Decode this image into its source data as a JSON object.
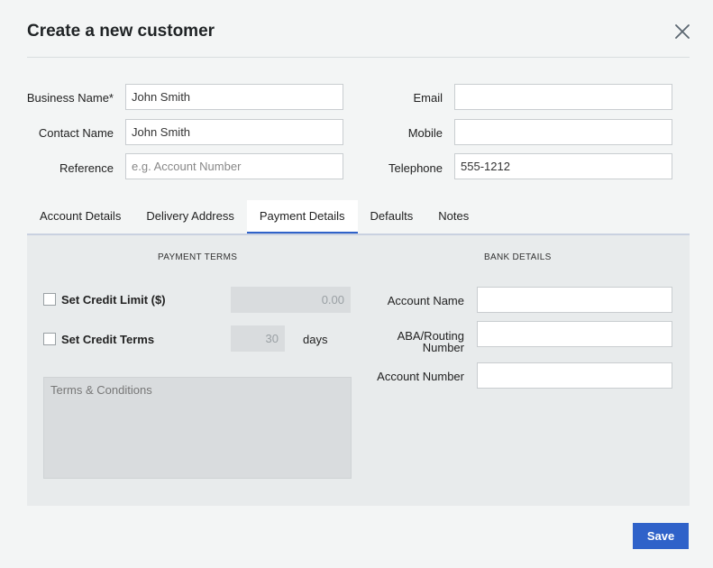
{
  "dialog": {
    "title": "Create a new customer"
  },
  "contact": {
    "business_name_label": "Business Name*",
    "business_name_value": "John Smith",
    "contact_name_label": "Contact Name",
    "contact_name_value": "John Smith",
    "reference_label": "Reference",
    "reference_placeholder": "e.g. Account Number",
    "email_label": "Email",
    "email_value": "",
    "mobile_label": "Mobile",
    "mobile_value": "",
    "telephone_label": "Telephone",
    "telephone_value": "555-1212"
  },
  "tabs": [
    {
      "label": "Account Details",
      "active": false
    },
    {
      "label": "Delivery Address",
      "active": false
    },
    {
      "label": "Payment Details",
      "active": true
    },
    {
      "label": "Defaults",
      "active": false
    },
    {
      "label": "Notes",
      "active": false
    }
  ],
  "payment_terms": {
    "heading": "PAYMENT TERMS",
    "credit_limit_label": "Set Credit Limit ($)",
    "credit_limit_checked": false,
    "credit_limit_value": "0.00",
    "credit_terms_label": "Set Credit Terms",
    "credit_terms_checked": false,
    "credit_terms_value": "30",
    "days_label": "days",
    "terms_placeholder": "Terms & Conditions"
  },
  "bank_details": {
    "heading": "BANK DETAILS",
    "account_name_label": "Account Name",
    "routing_label_line1": "ABA/Routing",
    "routing_label_line2": "Number",
    "account_number_label": "Account Number"
  },
  "footer": {
    "save_label": "Save"
  },
  "colors": {
    "accent": "#2f62c9",
    "background": "#f3f5f5",
    "panel": "#e8ebec"
  }
}
